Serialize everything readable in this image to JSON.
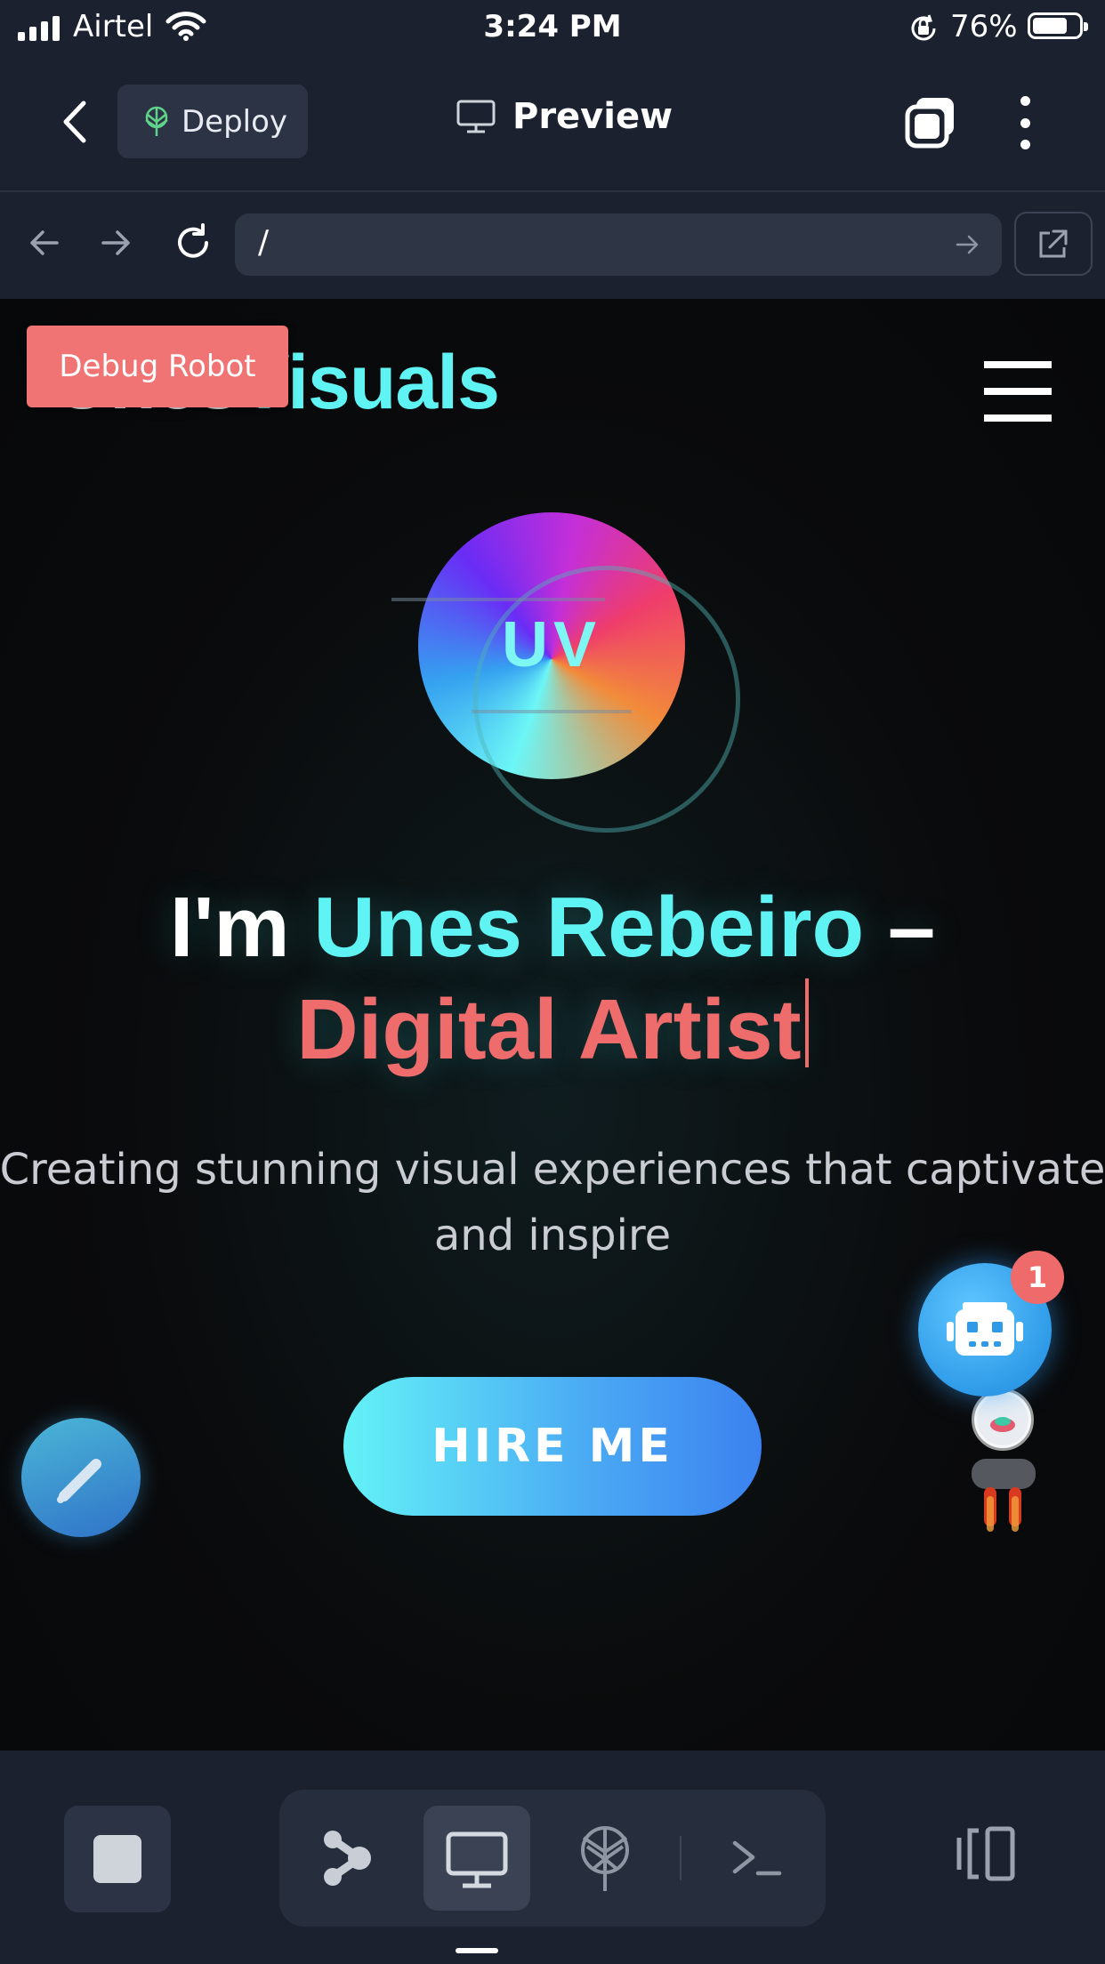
{
  "status_bar": {
    "carrier": "Airtel",
    "time": "3:24 PM",
    "battery_percent": "76%",
    "battery_level": 0.76
  },
  "header": {
    "deploy_label": "Deploy",
    "title": "Preview"
  },
  "browser": {
    "url": "/"
  },
  "site": {
    "logo_part1": "Unes",
    "logo_part2": "Visuals",
    "debug_badge": "Debug Robot",
    "avatar_initials": "UV",
    "headline_prefix": "I'm ",
    "headline_name": "Unes Rebeiro",
    "headline_dash": " –",
    "headline_role": "Digital Artist",
    "subtitle": "Creating stunning visual experiences that captivate and inspire",
    "cta": "HIRE ME",
    "notification_count": "1"
  },
  "colors": {
    "accent_cyan": "#5ff3f3",
    "accent_coral": "#ee6c6c",
    "app_bar": "#1c2130",
    "cta_start": "#63f2f7",
    "cta_end": "#3b82f0"
  },
  "icons": {
    "back": "chevron-left-icon",
    "deploy": "deploy-tree-icon",
    "preview": "monitor-icon",
    "tabs": "tabs-icon",
    "more": "more-vertical-icon",
    "nav_back": "arrow-left-icon",
    "nav_forward": "arrow-right-icon",
    "reload": "reload-icon",
    "go": "arrow-right-icon",
    "external": "external-link-icon",
    "menu": "hamburger-icon",
    "edit": "pencil-icon",
    "robot": "robot-icon",
    "stop": "stop-icon",
    "graph": "graph-icon",
    "monitor": "monitor-icon",
    "deploy_tab": "deploy-tree-icon",
    "terminal": "terminal-icon",
    "layout": "layout-panels-icon"
  }
}
